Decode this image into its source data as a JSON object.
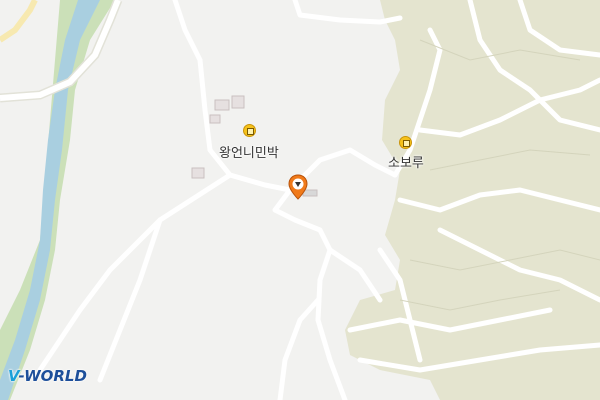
{
  "map": {
    "colors": {
      "background": "#f2f2f0",
      "terrain": "#e4e4cf",
      "river": "#a9cfe0",
      "riverbank": "#cbe0b8",
      "road": "#ffffff",
      "poi": "#f6c21a",
      "marker": "#f07a1a"
    }
  },
  "pois": [
    {
      "label": "왕언니민박",
      "icon": "lodging-icon"
    },
    {
      "label": "소보루",
      "icon": "lodging-icon"
    }
  ],
  "marker": {
    "icon": "location-pin-icon"
  },
  "logo": {
    "prefix": "V",
    "text": "-WORLD"
  }
}
